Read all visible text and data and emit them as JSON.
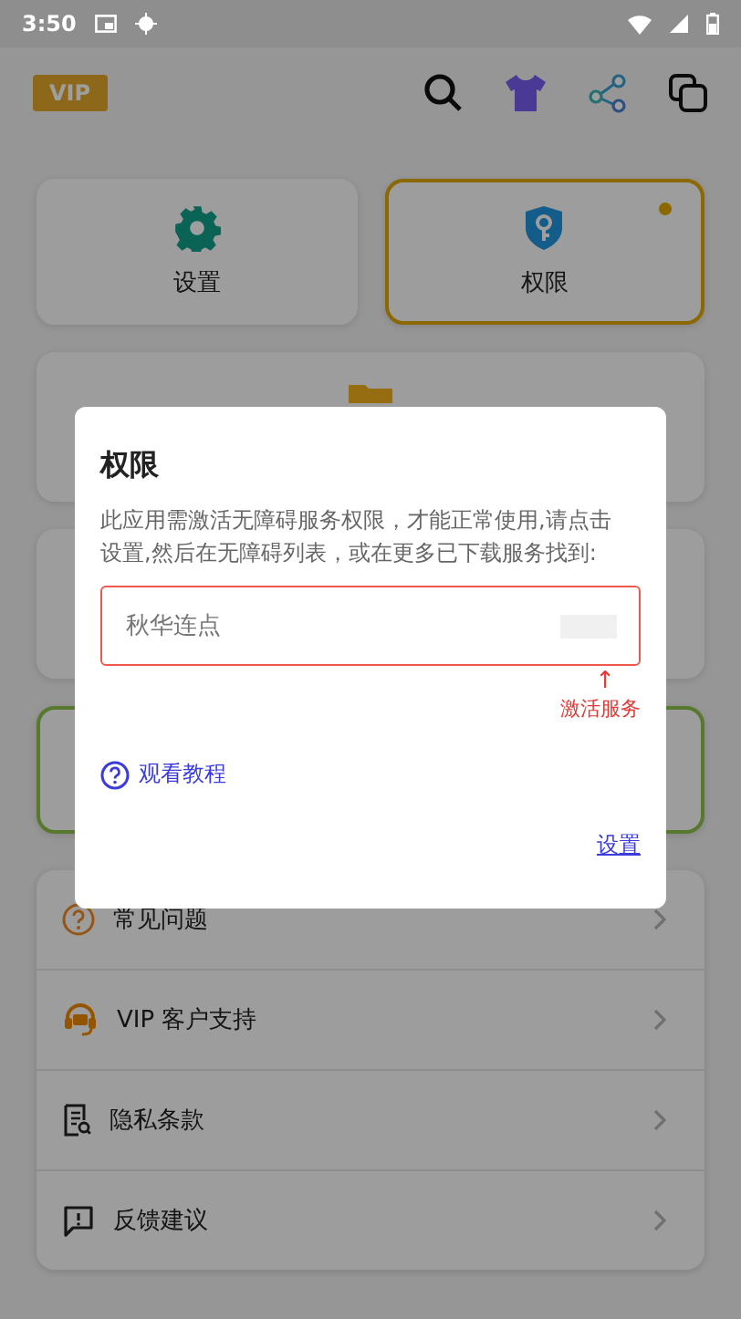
{
  "status_bar": {
    "time": "3:50"
  },
  "header": {
    "badge": "VIP"
  },
  "tiles": [
    {
      "label": "设置",
      "kind": "gear",
      "highlighted": false
    },
    {
      "label": "权限",
      "kind": "shield",
      "highlighted": true
    }
  ],
  "menu": [
    {
      "kind": "question",
      "label": "常见问题"
    },
    {
      "kind": "headset",
      "label": "VIP 客户支持"
    },
    {
      "kind": "document",
      "label": "隐私条款"
    },
    {
      "kind": "feedback",
      "label": "反馈建议"
    }
  ],
  "dialog": {
    "title": "权限",
    "message": "此应用需激活无障碍服务权限，才能正常使用,请点击设置,然后在无障碍列表，或在更多已下载服务找到:",
    "service": "秋华连点",
    "hint_arrow": "↑",
    "hint": "激活服务",
    "tutorial_link": "观看教程",
    "action": "设置"
  }
}
